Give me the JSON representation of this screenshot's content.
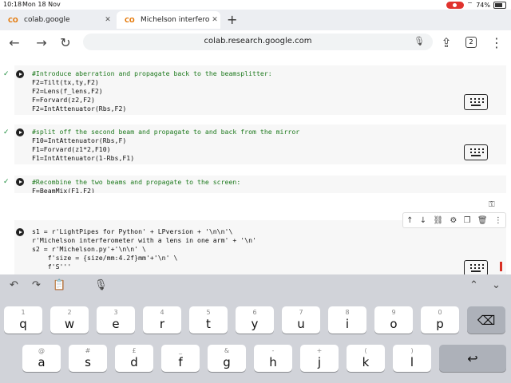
{
  "status_bar": {
    "time": "10:18",
    "date": "Mon 18 Nov",
    "battery": "74%"
  },
  "tabs": [
    {
      "label": "colab.google",
      "favicon": "CO",
      "active": false
    },
    {
      "label": "Michelson interferomete",
      "favicon": "CO",
      "active": true
    }
  ],
  "address_bar": {
    "url": "colab.research.google.com",
    "tab_count": "2"
  },
  "cells": [
    {
      "comment": "#Introduce aberration and propagate back to the beamsplitter:",
      "lines": [
        "F2=Tilt(tx,ty,F2)",
        "F2=Lens(f_lens,F2)",
        "F=Forvard(z2,F2)",
        "F2=IntAttenuator(Rbs,F2)"
      ]
    },
    {
      "comment": "#split off the second beam and propagate to and back from the mirror",
      "lines": [
        "F10=IntAttenuator(Rbs,F)",
        "F1=Forvard(z1*2,F10)",
        "F1=IntAttenuator(1-Rbs,F1)"
      ]
    },
    {
      "comment": "#Recombine the two beams and propagate to the screen:",
      "lines": [
        "F=BeamMix(F1,F2)"
      ]
    }
  ],
  "editing_cell": {
    "lines": [
      "s1 = r'LightPipes for Python' + LPversion + '\\n\\n'\\",
      "r'Michelson interferometer with a lens in one arm' + '\\n'",
      "s2 = r'Michelson.py'+'\\n\\n' \\",
      "    f'size = {size/mm:4.2f}mm'+'\\n' \\",
      "    f'S'''"
    ]
  },
  "keyboard": {
    "row1": [
      {
        "hint": "1",
        "key": "q"
      },
      {
        "hint": "2",
        "key": "w"
      },
      {
        "hint": "3",
        "key": "e"
      },
      {
        "hint": "4",
        "key": "r"
      },
      {
        "hint": "5",
        "key": "t"
      },
      {
        "hint": "6",
        "key": "y"
      },
      {
        "hint": "7",
        "key": "u"
      },
      {
        "hint": "8",
        "key": "i"
      },
      {
        "hint": "9",
        "key": "o"
      },
      {
        "hint": "0",
        "key": "p"
      }
    ],
    "row2": [
      {
        "hint": "@",
        "key": "a"
      },
      {
        "hint": "#",
        "key": "s"
      },
      {
        "hint": "£",
        "key": "d"
      },
      {
        "hint": "_",
        "key": "f"
      },
      {
        "hint": "&",
        "key": "g"
      },
      {
        "hint": "-",
        "key": "h"
      },
      {
        "hint": "+",
        "key": "j"
      },
      {
        "hint": "(",
        "key": "k"
      },
      {
        "hint": ")",
        "key": "l"
      }
    ]
  },
  "colors": {
    "tab_bar": "#eceef2",
    "keyboard_bg": "#d1d3d9",
    "comment": "#1f7a1f",
    "string": "#b5271f",
    "accent_red": "#d93025"
  }
}
